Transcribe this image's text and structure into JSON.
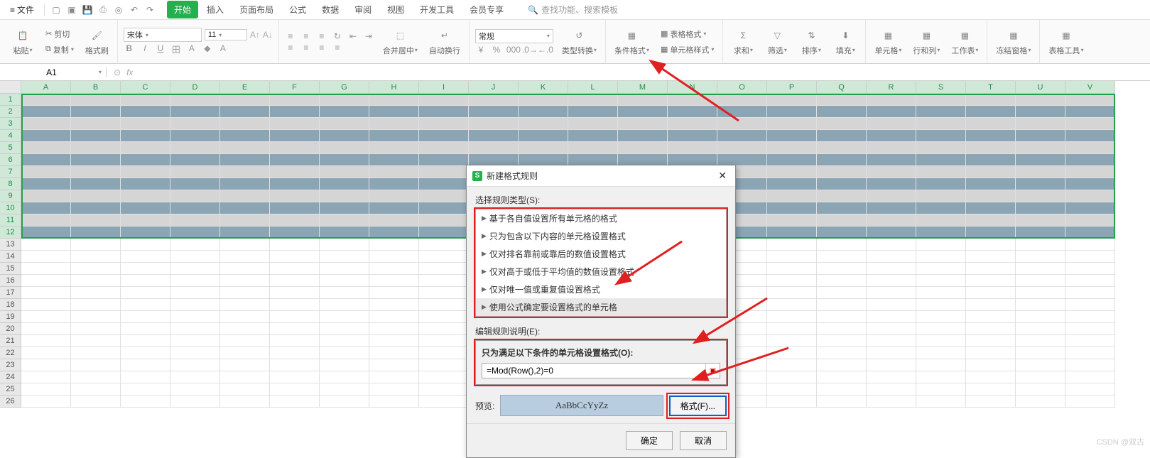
{
  "menu": {
    "file": "文件",
    "tabs": [
      "开始",
      "插入",
      "页面布局",
      "公式",
      "数据",
      "审阅",
      "视图",
      "开发工具",
      "会员专享"
    ],
    "active_tab": 0,
    "search_placeholder": "查找功能、搜索模板"
  },
  "ribbon": {
    "paste": "粘贴",
    "cut": "剪切",
    "copy": "复制",
    "format_painter": "格式刷",
    "font_name": "宋体",
    "font_size": "11",
    "merge_center": "合并居中",
    "auto_wrap": "自动换行",
    "number_format": "常规",
    "type_convert": "类型转换",
    "cond_format": "条件格式",
    "table_format": "表格格式",
    "cell_style": "单元格样式",
    "sum": "求和",
    "filter": "筛选",
    "sort": "排序",
    "fill": "填充",
    "cells": "单元格",
    "rowcol": "行和列",
    "worksheet": "工作表",
    "freeze": "冻结窗格",
    "table_tools": "表格工具"
  },
  "namebox": "A1",
  "columns": [
    "A",
    "B",
    "C",
    "D",
    "E",
    "F",
    "G",
    "H",
    "I",
    "J",
    "K",
    "L",
    "M",
    "N",
    "O",
    "P",
    "Q",
    "R",
    "S",
    "T",
    "U",
    "V"
  ],
  "row_count": 26,
  "selection_rows": 12,
  "dialog": {
    "title": "新建格式规则",
    "select_type_label": "选择规则类型(S):",
    "rule_types": [
      "基于各自值设置所有单元格的格式",
      "只为包含以下内容的单元格设置格式",
      "仅对排名靠前或靠后的数值设置格式",
      "仅对高于或低于平均值的数值设置格式",
      "仅对唯一值或重复值设置格式",
      "使用公式确定要设置格式的单元格"
    ],
    "selected_rule": 5,
    "edit_label": "编辑规则说明(E):",
    "cond_label": "只为满足以下条件的单元格设置格式(O):",
    "formula": "=Mod(Row(),2)=0",
    "preview_label": "预览:",
    "preview_text": "AaBbCcYyZz",
    "format_btn": "格式(F)...",
    "ok": "确定",
    "cancel": "取消"
  },
  "watermark": "CSDN @双古"
}
